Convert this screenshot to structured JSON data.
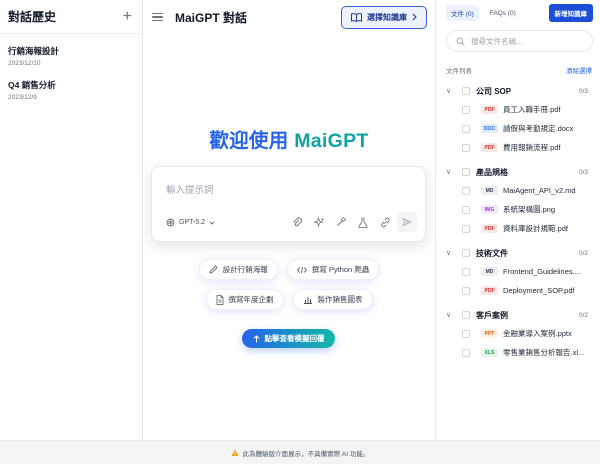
{
  "sidebar": {
    "title": "對話歷史",
    "new_icon": "plus-icon",
    "conversations": [
      {
        "title": "行銷海報設計",
        "date": "2023/12/10"
      },
      {
        "title": "Q4 銷售分析",
        "date": "2023/12/9"
      }
    ]
  },
  "header": {
    "title": "MaiGPT 對話",
    "kb_button": "選擇知識庫"
  },
  "main": {
    "welcome_prefix": "歡迎使用 ",
    "welcome_brand": "MaiGPT",
    "prompt_placeholder": "輸入提示詞",
    "model": "GPT-5.2",
    "tools": [
      "paperclip-icon",
      "sparkle-icon",
      "wand-icon",
      "flask-icon",
      "link-icon",
      "send-icon"
    ],
    "chips": [
      {
        "label": "設計行銷海報",
        "icon": "pen-icon"
      },
      {
        "label": "撰寫 Python 爬蟲",
        "icon": "code-icon"
      },
      {
        "label": "撰寫年度企劃",
        "icon": "document-icon"
      },
      {
        "label": "製作銷售圖表",
        "icon": "bar-chart-icon"
      }
    ],
    "demo_button": "點擊查看模擬回覆"
  },
  "right": {
    "tab_docs": "文件 (0)",
    "tab_faqs": "FAQs (0)",
    "new_kb": "新增知識庫",
    "search_placeholder": "搜尋文件名稱...",
    "list_label": "文件列表",
    "clear_label": "清除選擇",
    "folders": [
      {
        "name": "公司 SOP",
        "count": "0/3",
        "files": [
          {
            "type": "PDF",
            "name": "員工入職手冊.pdf"
          },
          {
            "type": "DOC",
            "name": "請假與考勤規定.docx"
          },
          {
            "type": "PDF",
            "name": "費用報銷流程.pdf"
          }
        ]
      },
      {
        "name": "產品規格",
        "count": "0/3",
        "files": [
          {
            "type": "MD",
            "name": "MaiAgent_API_v2.md"
          },
          {
            "type": "IMG",
            "name": "系統架構圖.png"
          },
          {
            "type": "PDF",
            "name": "資料庫設計規範.pdf"
          }
        ]
      },
      {
        "name": "技術文件",
        "count": "0/2",
        "files": [
          {
            "type": "MD",
            "name": "Frontend_Guidelines...."
          },
          {
            "type": "PDF",
            "name": "Deployment_SOP.pdf"
          }
        ]
      },
      {
        "name": "客戶案例",
        "count": "0/2",
        "files": [
          {
            "type": "PPT",
            "name": "金融業導入案例.pptx"
          },
          {
            "type": "XLS",
            "name": "零售業銷售分析報告.xl..."
          }
        ]
      }
    ],
    "badge_colors": {
      "PDF": {
        "bg": "#fde8e8",
        "fg": "#dc2626"
      },
      "DOC": {
        "bg": "#e0ecff",
        "fg": "#2563eb"
      },
      "MD": {
        "bg": "#eceef1",
        "fg": "#374151"
      },
      "IMG": {
        "bg": "#f3e8ff",
        "fg": "#9333ea"
      },
      "PPT": {
        "bg": "#fff1e0",
        "fg": "#ea580c"
      },
      "XLS": {
        "bg": "#e3f7ea",
        "fg": "#16a34a"
      }
    }
  },
  "footer": {
    "icon": "warning-icon",
    "text": "此為體驗版介面展示，不具備實際 AI 功能。"
  }
}
